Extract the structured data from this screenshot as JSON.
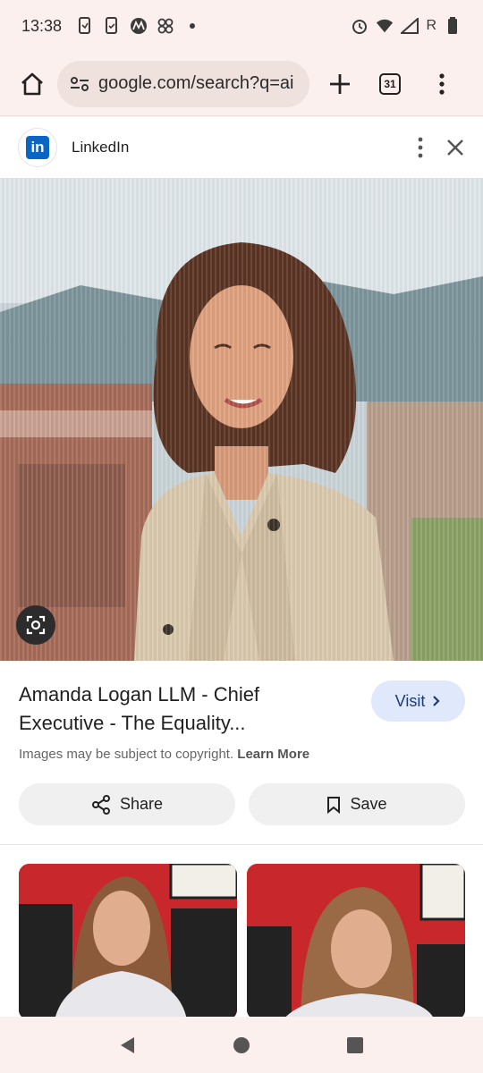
{
  "status_bar": {
    "time": "13:38",
    "carrier_label": "R"
  },
  "toolbar": {
    "url": "google.com/search?q=ai",
    "tab_count": "31"
  },
  "panel": {
    "source_name": "LinkedIn"
  },
  "result": {
    "title": "Amanda Logan LLM - Chief Executive - The Equality...",
    "visit_label": "Visit",
    "copyright_text": "Images may be subject to copyright.",
    "learn_more_label": "Learn More",
    "share_label": "Share",
    "save_label": "Save"
  }
}
